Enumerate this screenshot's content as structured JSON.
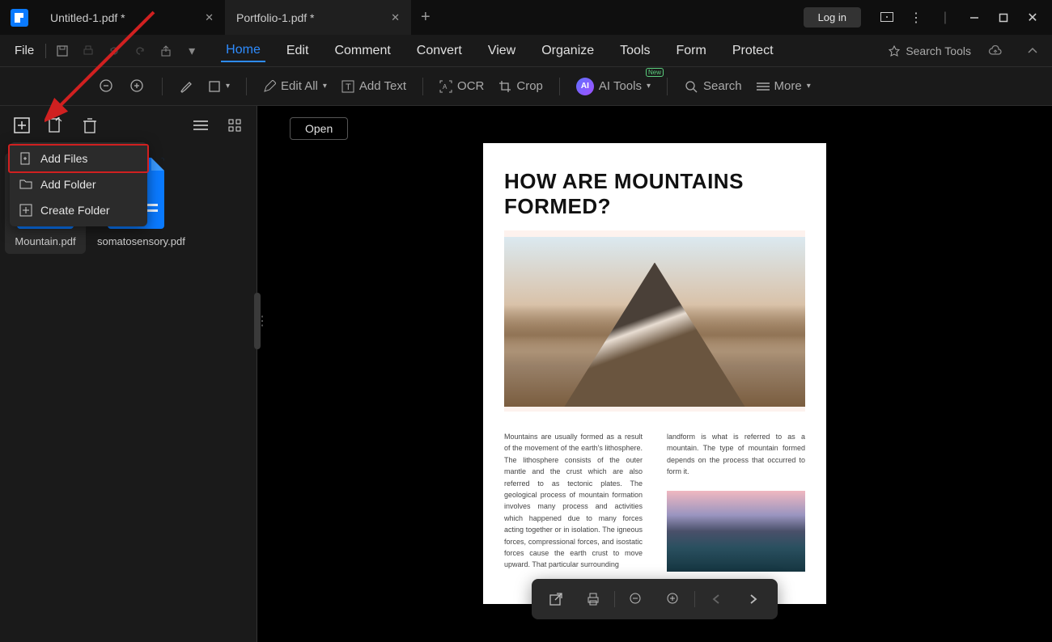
{
  "titlebar": {
    "tabs": [
      {
        "label": "Untitled-1.pdf *",
        "active": false
      },
      {
        "label": "Portfolio-1.pdf *",
        "active": true
      }
    ],
    "login": "Log in"
  },
  "menubar": {
    "file": "File",
    "tabs": [
      "Home",
      "Edit",
      "Comment",
      "Convert",
      "View",
      "Organize",
      "Tools",
      "Form",
      "Protect"
    ],
    "search_tools": "Search Tools"
  },
  "toolbar": {
    "edit_all": "Edit All",
    "add_text": "Add Text",
    "ocr": "OCR",
    "crop": "Crop",
    "ai_tools": "AI Tools",
    "ai_new": "New",
    "search": "Search",
    "more": "More"
  },
  "sidebar": {
    "files": [
      {
        "name": "Mountain.pdf",
        "selected": true
      },
      {
        "name": "somatosensory.pdf",
        "selected": false
      }
    ]
  },
  "context_menu": {
    "items": [
      {
        "label": "Add Files",
        "highlighted": true
      },
      {
        "label": "Add Folder",
        "highlighted": false
      },
      {
        "label": "Create Folder",
        "highlighted": false
      }
    ]
  },
  "viewer": {
    "open": "Open",
    "doc": {
      "title": "HOW ARE MOUNTAINS FORMED?",
      "col1": "Mountains are usually formed as a result of the movement of the earth's lithosphere. The lithosphere consists of the outer mantle and the crust which are also referred to as tectonic plates. The geological process of mountain formation involves many process and activities which happened due to many forces acting together or in isolation. The igneous forces, compressional forces, and isostatic forces cause the earth crust to move upward. That particular surrounding",
      "col2": "landform is what is referred to as a mountain. The type of mountain formed depends on the process that occurred to form it."
    }
  }
}
